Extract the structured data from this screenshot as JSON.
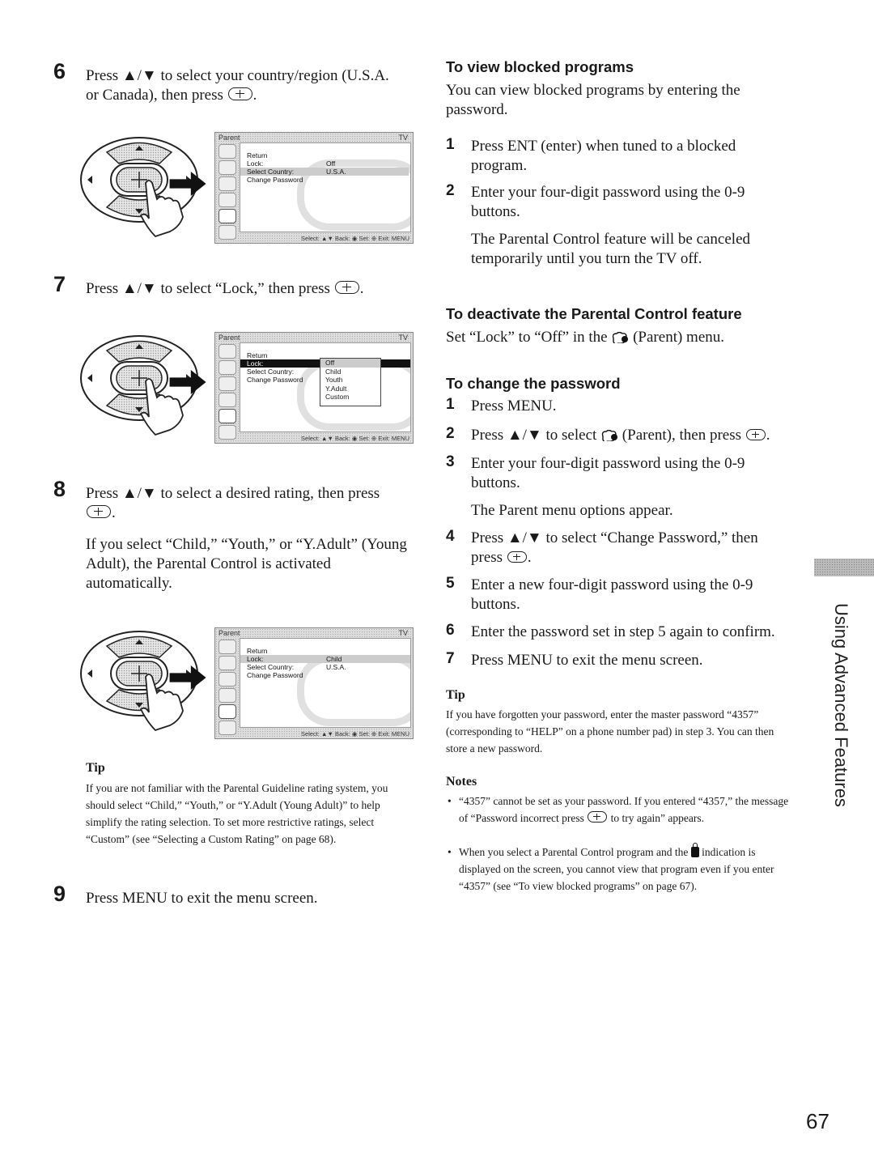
{
  "left": {
    "step6": {
      "num": "6",
      "text_a": "Press ▲/▼ to select your country/region (U.S.A.",
      "text_b": "or Canada), then press",
      "text_end": "."
    },
    "screen1": {
      "title": "Parent",
      "tv_label": "TV",
      "rows": [
        {
          "label": "Return",
          "value": ""
        },
        {
          "label": "Lock:",
          "value": "Off"
        },
        {
          "label": "Select Country:",
          "value": "U.S.A."
        },
        {
          "label": "Change Password",
          "value": ""
        }
      ],
      "footer": "Select: ▲▼  Back: ◉  Set: ⊕  Exit: MENU"
    },
    "step7": {
      "num": "7",
      "text": "Press ▲/▼ to select “Lock,” then press",
      "text_end": "."
    },
    "screen2": {
      "title": "Parent",
      "tv_label": "TV",
      "rows": [
        {
          "label": "Return",
          "value": ""
        },
        {
          "label": "Lock:",
          "value": ""
        },
        {
          "label": "Select Country:",
          "value": ""
        },
        {
          "label": "Change Password",
          "value": ""
        }
      ],
      "dropdown": [
        "Off",
        "Child",
        "Youth",
        "Y.Adult",
        "Custom"
      ],
      "footer": "Select: ▲▼  Back: ◉  Set: ⊕  Exit: MENU"
    },
    "step8": {
      "num": "8",
      "text": "Press ▲/▼ to select a desired rating, then press",
      "text_end": ".",
      "para": "If you select “Child,” “Youth,” or “Y.Adult” (Young Adult), the Parental Control is activated automatically."
    },
    "screen3": {
      "title": "Parent",
      "tv_label": "TV",
      "rows": [
        {
          "label": "Return",
          "value": ""
        },
        {
          "label": "Lock:",
          "value": "Child"
        },
        {
          "label": "Select Country:",
          "value": "U.S.A."
        },
        {
          "label": "Change Password",
          "value": ""
        }
      ],
      "footer": "Select: ▲▼  Back: ◉  Set: ⊕  Exit: MENU"
    },
    "tip": {
      "heading": "Tip",
      "text": "If you are not familiar with the Parental Guideline rating system, you should select “Child,” “Youth,” or “Y.Adult (Young Adult)” to help simplify the rating selection. To set more restrictive ratings, select “Custom” (see “Selecting a Custom Rating” on page 68)."
    },
    "step9": {
      "num": "9",
      "text": "Press MENU to exit the menu screen."
    }
  },
  "right": {
    "view_blocked": {
      "heading": "To view blocked programs",
      "intro": "You can view blocked programs by entering the password.",
      "steps": [
        {
          "num": "1",
          "text": "Press ENT (enter) when tuned to a blocked program."
        },
        {
          "num": "2",
          "text": "Enter your four-digit password using the 0-9 buttons."
        }
      ],
      "note": "The Parental Control feature will be canceled temporarily until you turn the TV off."
    },
    "deactivate": {
      "heading": "To deactivate the Parental Control feature",
      "text_a": "Set “Lock” to “Off” in the",
      "text_b": "(Parent) menu."
    },
    "change_password": {
      "heading": "To change the password",
      "steps": [
        {
          "num": "1",
          "text": "Press MENU."
        },
        {
          "num": "2",
          "text_a": "Press ▲/▼ to select",
          "text_b": "(Parent), then press",
          "text_end": "."
        },
        {
          "num": "3",
          "text": "Enter your four-digit password using the 0-9 buttons."
        },
        {
          "num": "4",
          "text_a": "Press ▲/▼ to select “Change Password,” then press",
          "text_end": "."
        },
        {
          "num": "5",
          "text": "Enter a new four-digit password using the 0-9 buttons."
        },
        {
          "num": "6",
          "text": "Enter the password set in step 5 again to confirm."
        },
        {
          "num": "7",
          "text": "Press MENU to exit the menu screen."
        }
      ],
      "step3_note": "The Parent menu options appear."
    },
    "tip": {
      "heading": "Tip",
      "text": "If you have forgotten your password, enter the master password “4357” (corresponding to “HELP” on a phone number pad) in step 3. You can then store a new password."
    },
    "notes": {
      "heading": "Notes",
      "bullet1_a": "“4357” cannot be set as your password. If you entered “4357,” the message of “Password incorrect press",
      "bullet1_b": "to try again” appears.",
      "bullet2_a": "When you select a Parental Control program and the",
      "bullet2_b": "indication is displayed on the screen, you cannot view that program even if you enter “4357” (see “To view blocked programs” on page 67)."
    }
  },
  "side_tab": {
    "label": "Using Advanced Features"
  },
  "page_number": "67"
}
